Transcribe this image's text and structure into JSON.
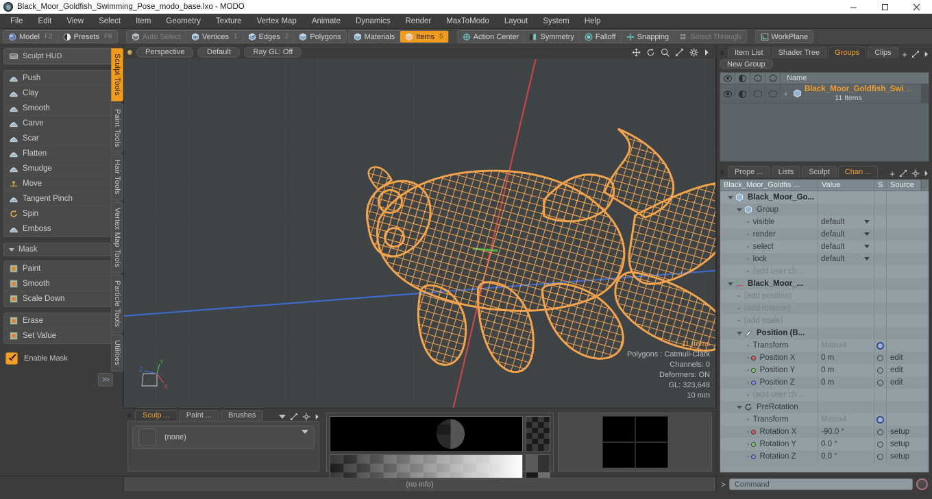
{
  "window": {
    "title": "Black_Moor_Goldfish_Swimming_Pose_modo_base.lxo - MODO",
    "logo_icon": "modo-logo-icon",
    "buttons": [
      {
        "name": "minimize-button",
        "icon": "minimize-icon"
      },
      {
        "name": "maximize-button",
        "icon": "maximize-icon"
      },
      {
        "name": "close-button",
        "icon": "close-icon"
      }
    ]
  },
  "menubar": {
    "items": [
      "File",
      "Edit",
      "View",
      "Select",
      "Item",
      "Geometry",
      "Texture",
      "Vertex Map",
      "Animate",
      "Dynamics",
      "Render",
      "MaxToModo",
      "Layout",
      "System",
      "Help"
    ]
  },
  "modebar": {
    "group1": [
      {
        "label": "Model",
        "hotkey": "F2",
        "icon": "sphere-blue-icon",
        "state": "normal"
      },
      {
        "label": "Presets",
        "hotkey": "F6",
        "icon": "sphere-half-icon",
        "state": "normal"
      }
    ],
    "group2": [
      {
        "label": "Auto Select",
        "hotkey": "",
        "icon": "cube-grey-icon",
        "state": "dim"
      },
      {
        "label": "Vertices",
        "hotkey": "1",
        "icon": "cube-vertex-icon",
        "state": "normal"
      },
      {
        "label": "Edges",
        "hotkey": "2",
        "icon": "cube-edge-icon",
        "state": "normal"
      },
      {
        "label": "Polygons",
        "hotkey": "",
        "icon": "cube-poly-icon",
        "state": "normal"
      }
    ],
    "group3": [
      {
        "label": "Materials",
        "hotkey": "",
        "icon": "cube-material-icon",
        "state": "normal"
      },
      {
        "label": "Items",
        "hotkey": "5",
        "icon": "cube-item-icon",
        "state": "active"
      }
    ],
    "group4": [
      {
        "label": "Action Center",
        "hotkey": "",
        "icon": "action-center-icon",
        "state": "normal"
      },
      {
        "label": "Symmetry",
        "hotkey": "",
        "icon": "symmetry-icon",
        "state": "normal"
      },
      {
        "label": "Falloff",
        "hotkey": "",
        "icon": "falloff-icon",
        "state": "normal"
      },
      {
        "label": "Snapping",
        "hotkey": "",
        "icon": "snapping-icon",
        "state": "normal"
      },
      {
        "label": "Select Through",
        "hotkey": "",
        "icon": "select-through-icon",
        "state": "dim"
      }
    ],
    "group5": [
      {
        "label": "WorkPlane",
        "hotkey": "",
        "icon": "workplane-icon",
        "state": "normal"
      }
    ]
  },
  "sidebar": {
    "hud": {
      "label": "Sculpt HUD",
      "icon": "hud-icon"
    },
    "sculpt_tools": [
      {
        "label": "Push",
        "icon": "push-brush-icon",
        "expandable": true
      },
      {
        "label": "Clay",
        "icon": "clay-brush-icon",
        "expandable": false
      },
      {
        "label": "Smooth",
        "icon": "smooth-brush-icon",
        "expandable": false
      },
      {
        "label": "Carve",
        "icon": "carve-brush-icon",
        "expandable": false
      },
      {
        "label": "Scar",
        "icon": "scar-brush-icon",
        "expandable": false
      },
      {
        "label": "Flatten",
        "icon": "flatten-brush-icon",
        "expandable": false
      },
      {
        "label": "Smudge",
        "icon": "smudge-brush-icon",
        "expandable": false
      },
      {
        "label": "Move",
        "icon": "move-brush-icon",
        "expandable": false
      },
      {
        "label": "Tangent Pinch",
        "icon": "tangent-pinch-icon",
        "expandable": true
      },
      {
        "label": "Spin",
        "icon": "spin-brush-icon",
        "expandable": false
      },
      {
        "label": "Emboss",
        "icon": "emboss-brush-icon",
        "expandable": true
      }
    ],
    "mask_section": {
      "label": "Mask"
    },
    "mask_tools": [
      {
        "label": "Paint",
        "icon": "mask-paint-icon"
      },
      {
        "label": "Smooth",
        "icon": "mask-smooth-icon"
      },
      {
        "label": "Scale Down",
        "icon": "mask-scale-down-icon"
      }
    ],
    "mask_tools2": [
      {
        "label": "Erase",
        "icon": "mask-erase-icon"
      },
      {
        "label": "Set Value",
        "icon": "mask-set-value-icon"
      }
    ],
    "enable_mask": {
      "label": "Enable Mask",
      "checked": true
    },
    "more_button": ">>",
    "vertical_tabs": [
      {
        "label": "Sculpt Tools",
        "active": true
      },
      {
        "label": "Paint Tools",
        "active": false
      },
      {
        "label": "Hair Tools",
        "active": false
      },
      {
        "label": "Vertex Map Tools",
        "active": false
      },
      {
        "label": "Particle Tools",
        "active": false
      },
      {
        "label": "Utilities",
        "active": false
      }
    ]
  },
  "viewport": {
    "buttons": [
      "Perspective",
      "Default",
      "Ray GL: Off"
    ],
    "icons": [
      "move-view-icon",
      "rotate-view-icon",
      "zoom-view-icon",
      "expand-view-icon",
      "gear-icon",
      "chevron-right-icon"
    ],
    "stats": {
      "items": "11 Items",
      "polygons": "Polygons : Catmull-Clark",
      "channels": "Channels: 0",
      "deformers": "Deformers: ON",
      "gl": "GL: 323,648",
      "scale": "10 mm"
    },
    "axes": {
      "x": "X",
      "y": "Y",
      "z": "Z"
    },
    "model_color": "#f5a44c",
    "background_color": "#3e4346"
  },
  "bottom_panel": {
    "tabs": [
      {
        "label": "Sculp ...",
        "active": true
      },
      {
        "label": "Paint ...",
        "active": false
      },
      {
        "label": "Brushes",
        "active": false
      }
    ],
    "tab_icons": [
      "chevron-down-icon",
      "expand-icon",
      "gear-icon",
      "chevron-right-icon"
    ],
    "brush_value": "(none)",
    "brush_thumb_icon": "brush-thumbnail-icon"
  },
  "right_panel": {
    "top_tabs": [
      {
        "label": "Item List",
        "active": false
      },
      {
        "label": "Shader Tree",
        "active": false
      },
      {
        "label": "Groups",
        "active": true
      },
      {
        "label": "Clips",
        "active": false
      }
    ],
    "top_tab_icons": [
      "plus-icon",
      "expand-icon",
      "chevron-right-icon"
    ],
    "new_group_label": "New Group",
    "group_columns": [
      "visible-eye-icon",
      "render-cap-icon",
      "lock-box-icon",
      "select-box-icon",
      "Name"
    ],
    "group_name_header": "Name",
    "group_rows": [
      {
        "name": "Black_Moor_Goldfish_Swi",
        "ellipsis": "...",
        "sub": "11 Items",
        "icon": "group-cube-icon",
        "plus": "+"
      }
    ],
    "bottom_tabs": [
      {
        "label": "Prope ...",
        "active": false
      },
      {
        "label": "Lists",
        "active": false
      },
      {
        "label": "Sculpt",
        "active": false
      },
      {
        "label": "Chan ...",
        "active": true
      }
    ],
    "bottom_tab_icons": [
      "plus-icon",
      "expand-icon",
      "gear-icon",
      "chevron-right-icon"
    ],
    "channel_columns": [
      "Black_Moor_Goldfis ...",
      "Value",
      "S",
      "Source"
    ],
    "channels": [
      {
        "indent": 0,
        "tri": true,
        "icon": "cube-icon",
        "label": "Black_Moor_Go...",
        "value": "",
        "s": "",
        "source": "",
        "bold": true
      },
      {
        "indent": 1,
        "tri": true,
        "icon": "cube-icon",
        "label": "Group",
        "value": "",
        "s": "",
        "source": "",
        "bold": false
      },
      {
        "indent": 2,
        "tri": false,
        "icon": "",
        "label": "visible",
        "value": "default",
        "s": "",
        "source": "",
        "dropdown": true
      },
      {
        "indent": 2,
        "tri": false,
        "icon": "",
        "label": "render",
        "value": "default",
        "s": "",
        "source": "",
        "dropdown": true
      },
      {
        "indent": 2,
        "tri": false,
        "icon": "",
        "label": "select",
        "value": "default",
        "s": "",
        "source": "",
        "dropdown": true
      },
      {
        "indent": 2,
        "tri": false,
        "icon": "",
        "label": "lock",
        "value": "default",
        "s": "",
        "source": "",
        "dropdown": true
      },
      {
        "indent": 2,
        "tri": false,
        "icon": "",
        "label": "(add user ch ...",
        "value": "",
        "s": "",
        "source": "",
        "dim": true
      },
      {
        "indent": 0,
        "tri": true,
        "icon": "axis-icon",
        "label": "Black_Moor_...",
        "value": "",
        "s": "",
        "source": "",
        "bold": true
      },
      {
        "indent": 1,
        "tri": false,
        "icon": "",
        "label": "(add position)",
        "value": "",
        "s": "",
        "source": "",
        "dim": true
      },
      {
        "indent": 1,
        "tri": false,
        "icon": "",
        "label": "(add rotation)",
        "value": "",
        "s": "",
        "source": "",
        "dim": true
      },
      {
        "indent": 1,
        "tri": false,
        "icon": "",
        "label": "(add scale)",
        "value": "",
        "s": "",
        "source": "",
        "dim": true
      },
      {
        "indent": 1,
        "tri": true,
        "icon": "position-icon",
        "label": "Position (B...",
        "value": "",
        "s": "",
        "source": "",
        "bold": true
      },
      {
        "indent": 2,
        "tri": false,
        "icon": "",
        "label": "Transform",
        "value": "Matrix4",
        "s": "gear",
        "source": "",
        "valuedim": true
      },
      {
        "indent": 2,
        "tri": false,
        "icon": "axis-x",
        "label": "Position X",
        "value": "0 m",
        "s": "circle",
        "source": "edit"
      },
      {
        "indent": 2,
        "tri": false,
        "icon": "axis-y",
        "label": "Position Y",
        "value": "0 m",
        "s": "circle",
        "source": "edit"
      },
      {
        "indent": 2,
        "tri": false,
        "icon": "axis-z",
        "label": "Position Z",
        "value": "0 m",
        "s": "circle",
        "source": "edit"
      },
      {
        "indent": 2,
        "tri": false,
        "icon": "",
        "label": "(add user ch ...",
        "value": "",
        "s": "",
        "source": "",
        "dim": true
      },
      {
        "indent": 1,
        "tri": true,
        "icon": "prerotation-icon",
        "label": "PreRotation",
        "value": "",
        "s": "",
        "source": "",
        "bold": false
      },
      {
        "indent": 2,
        "tri": false,
        "icon": "",
        "label": "Transform",
        "value": "Matrix4",
        "s": "gear",
        "source": "",
        "valuedim": true
      },
      {
        "indent": 2,
        "tri": false,
        "icon": "axis-x",
        "label": "Rotation X",
        "value": "-90.0 °",
        "s": "circle",
        "source": "setup"
      },
      {
        "indent": 2,
        "tri": false,
        "icon": "axis-y",
        "label": "Rotation Y",
        "value": "0.0 °",
        "s": "circle",
        "source": "setup"
      },
      {
        "indent": 2,
        "tri": false,
        "icon": "axis-z",
        "label": "Rotation Z",
        "value": "0.0 °",
        "s": "circle",
        "source": "setup"
      }
    ]
  },
  "statusbar": {
    "info": "(no info)",
    "command_prompt": ">",
    "command_placeholder": "Command",
    "record_icon": "record-icon"
  }
}
